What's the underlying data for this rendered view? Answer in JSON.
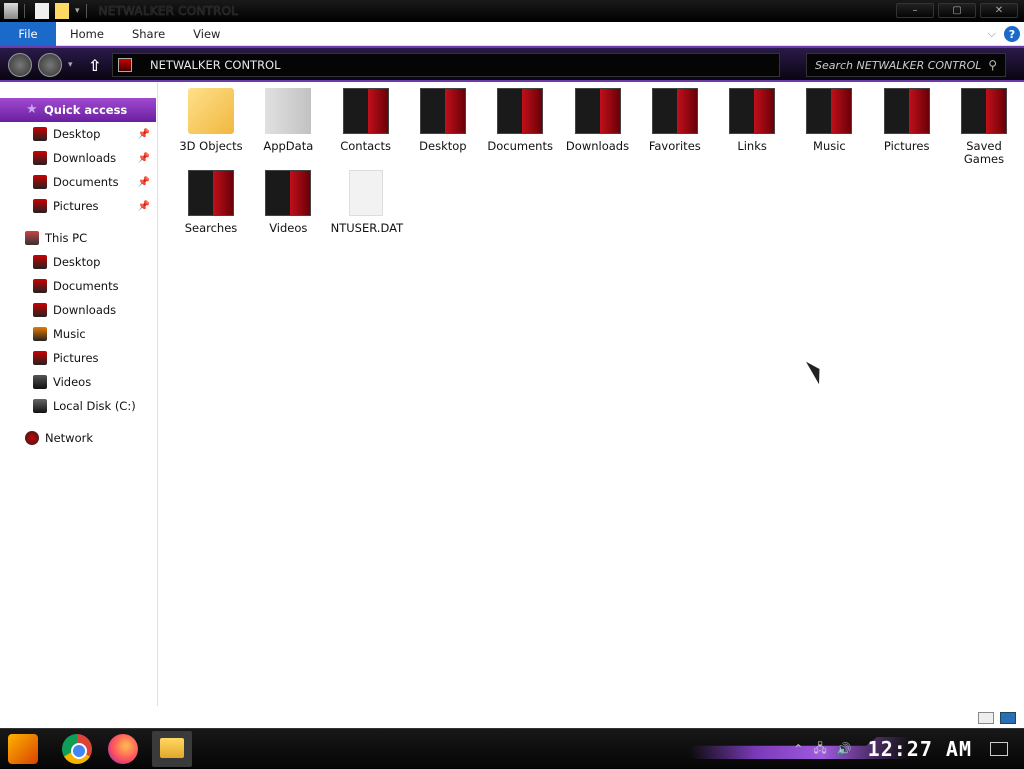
{
  "window": {
    "title": "NETWALKER CONTROL",
    "controls": [
      "–",
      "▢",
      "✕"
    ]
  },
  "ribbon": {
    "tabs": [
      "File",
      "Home",
      "Share",
      "View"
    ],
    "help": "?"
  },
  "address": {
    "path": "NETWALKER CONTROL",
    "search_placeholder": "Search NETWALKER CONTROL"
  },
  "nav_pane": {
    "quick_access": "Quick access",
    "quick_items": [
      "Desktop",
      "Downloads",
      "Documents",
      "Pictures"
    ],
    "this_pc": "This PC",
    "pc_items": [
      "Desktop",
      "Documents",
      "Downloads",
      "Music",
      "Pictures",
      "Videos",
      "Local Disk (C:)"
    ],
    "network": "Network"
  },
  "files": [
    {
      "label": "3D Objects",
      "icon": "3d-objects-folder-icon"
    },
    {
      "label": "AppData",
      "icon": "appdata-folder-icon"
    },
    {
      "label": "Contacts",
      "icon": "contacts-folder-icon"
    },
    {
      "label": "Desktop",
      "icon": "desktop-folder-icon"
    },
    {
      "label": "Documents",
      "icon": "documents-folder-icon"
    },
    {
      "label": "Downloads",
      "icon": "downloads-folder-icon"
    },
    {
      "label": "Favorites",
      "icon": "favorites-folder-icon"
    },
    {
      "label": "Links",
      "icon": "links-folder-icon"
    },
    {
      "label": "Music",
      "icon": "music-folder-icon"
    },
    {
      "label": "Pictures",
      "icon": "pictures-folder-icon"
    },
    {
      "label": "Saved Games",
      "icon": "saved-games-folder-icon"
    },
    {
      "label": "Searches",
      "icon": "searches-folder-icon"
    },
    {
      "label": "Videos",
      "icon": "videos-folder-icon"
    },
    {
      "label": "NTUSER.DAT",
      "icon": "file-icon"
    }
  ],
  "taskbar": {
    "clock": "12:27 AM",
    "pinned": [
      "start-icon",
      "chrome-icon",
      "firefox-icon",
      "file-explorer-icon"
    ]
  },
  "colors": {
    "accent_purple": "#7a2fb8",
    "file_tab_blue": "#1b6ac9",
    "folder_red": "#c0101a"
  }
}
